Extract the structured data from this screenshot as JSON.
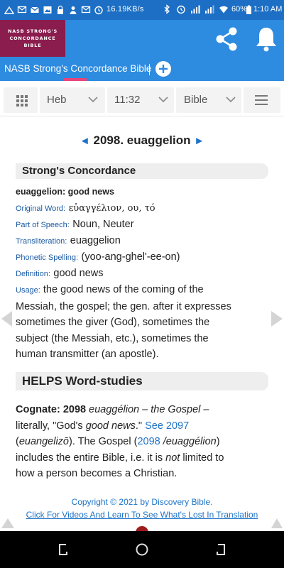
{
  "status_bar": {
    "network_speed": "16.19KB/s",
    "battery": "60%",
    "time": "1:10 AM",
    "left_icons": [
      "signal-icon",
      "message-icon",
      "gmail-icon",
      "image-icon",
      "lock-icon",
      "person-icon",
      "message-icon",
      "alarm-icon"
    ],
    "right_icons": [
      "bluetooth-icon",
      "alarm-icon",
      "signal-4g-icon",
      "signal-icon",
      "wifi-icon",
      "battery-icon"
    ]
  },
  "header": {
    "logo_lines": [
      "NASB STRONG'S",
      "CONCORDANCE",
      "BIBLE"
    ],
    "share_icon": "share-icon",
    "bell_icon": "bell-icon",
    "bg_color": "#2d8be0",
    "logo_color": "#8a1d4e"
  },
  "tabs": {
    "active_label": "NASB Strong's Concordance Bible",
    "add_icon": "plus-icon",
    "indicator_color": "#e8467a"
  },
  "toolbar": {
    "menu_icon": "grid-icon",
    "language": "Heb",
    "reference": "11:32",
    "version": "Bible",
    "more_icon": "hamburger-icon"
  },
  "entry": {
    "prev_arrow": "◄",
    "next_arrow": "►",
    "heading": "2098. euaggelion"
  },
  "strongs": {
    "section_title": "Strong's Concordance",
    "headword": "euaggelion: good news",
    "original_word_label": "Original Word:",
    "original_word": "εὐαγγέλιον, ου, τό",
    "part_of_speech_label": "Part of Speech:",
    "part_of_speech": "Noun, Neuter",
    "transliteration_label": "Transliteration:",
    "transliteration": "euaggelion",
    "phonetic_label": "Phonetic Spelling:",
    "phonetic": "(yoo-ang-ghel'-ee-on)",
    "definition_label": "Definition:",
    "definition": "good news",
    "usage_label": "Usage:",
    "usage_lines": [
      "the good news of the coming of the",
      "Messiah, the gospel; the gen. after it expresses",
      "sometimes the giver (God), sometimes the",
      "subject (the Messiah, etc.), sometimes the",
      "human transmitter (an apostle)."
    ]
  },
  "helps": {
    "section_title": "HELPS Word-studies",
    "cognate_label": "Cognate: 2098",
    "greek_term": "euaggélion",
    "dash_gloss": "– the Gospel –",
    "literally": "literally, \"God's",
    "good_news": "good news",
    "after_good_news": ".\"",
    "see_link": "See 2097",
    "paren_open": "(",
    "paren_term": "euangelizō",
    "paren_close": "). The Gospel (",
    "num_link": "2098",
    "term_after_link": "/euaggélion",
    "paren_close2": ")",
    "line3": "includes the entire Bible, i.e. it is",
    "not_word": "not",
    "line3_end": "limited to",
    "line4": "how a person becomes a Christian."
  },
  "footer": {
    "copyright": "Copyright © 2021 by Discovery Bible.",
    "ad_link": "Click For Videos And Learn To See What's Lost In Translation"
  },
  "navbar": {
    "back_icon": "back-icon",
    "home_icon": "home-icon",
    "recents_icon": "recents-icon"
  }
}
